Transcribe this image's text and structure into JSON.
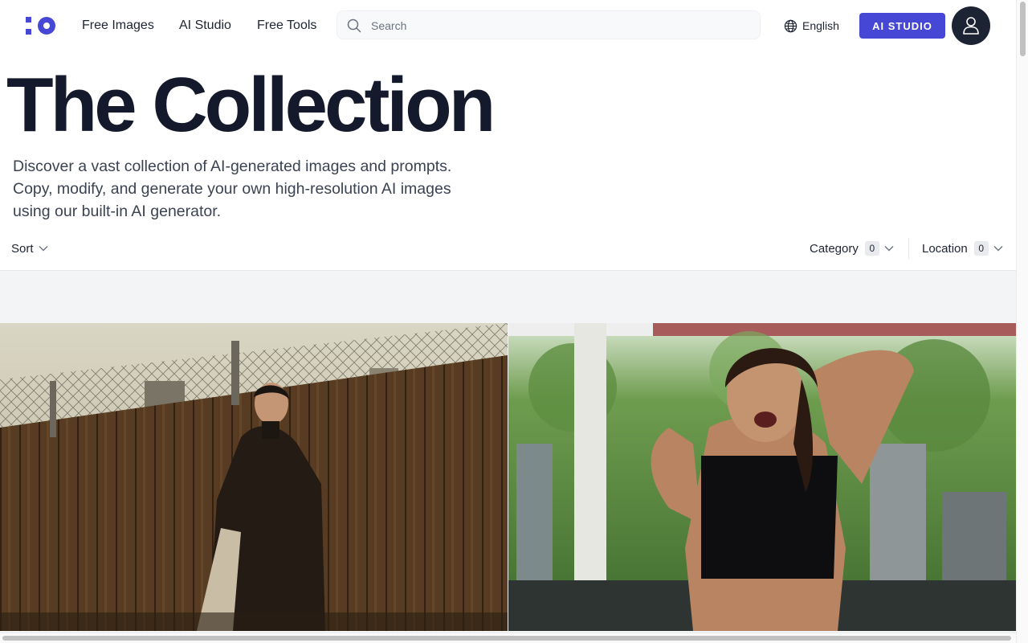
{
  "header": {
    "nav": [
      "Free Images",
      "AI Studio",
      "Free Tools"
    ],
    "search_placeholder": "Search",
    "language": "English",
    "studio_button": "AI STUDIO"
  },
  "hero": {
    "title": "The Collection",
    "description": "Discover a vast collection of AI-generated images and prompts. Copy, modify, and generate your own high-resolution AI images using our built-in AI generator."
  },
  "filters": {
    "sort_label": "Sort",
    "category_label": "Category",
    "category_count": "0",
    "location_label": "Location",
    "location_count": "0"
  },
  "icons": [
    "logo-icon",
    "search-icon",
    "globe-icon",
    "user-icon",
    "chevron-down-icon"
  ],
  "colors": {
    "accent": "#4747d6",
    "avatar_bg": "#1c2433",
    "title": "#141a2b",
    "grid_background": "#f3f4f6"
  }
}
